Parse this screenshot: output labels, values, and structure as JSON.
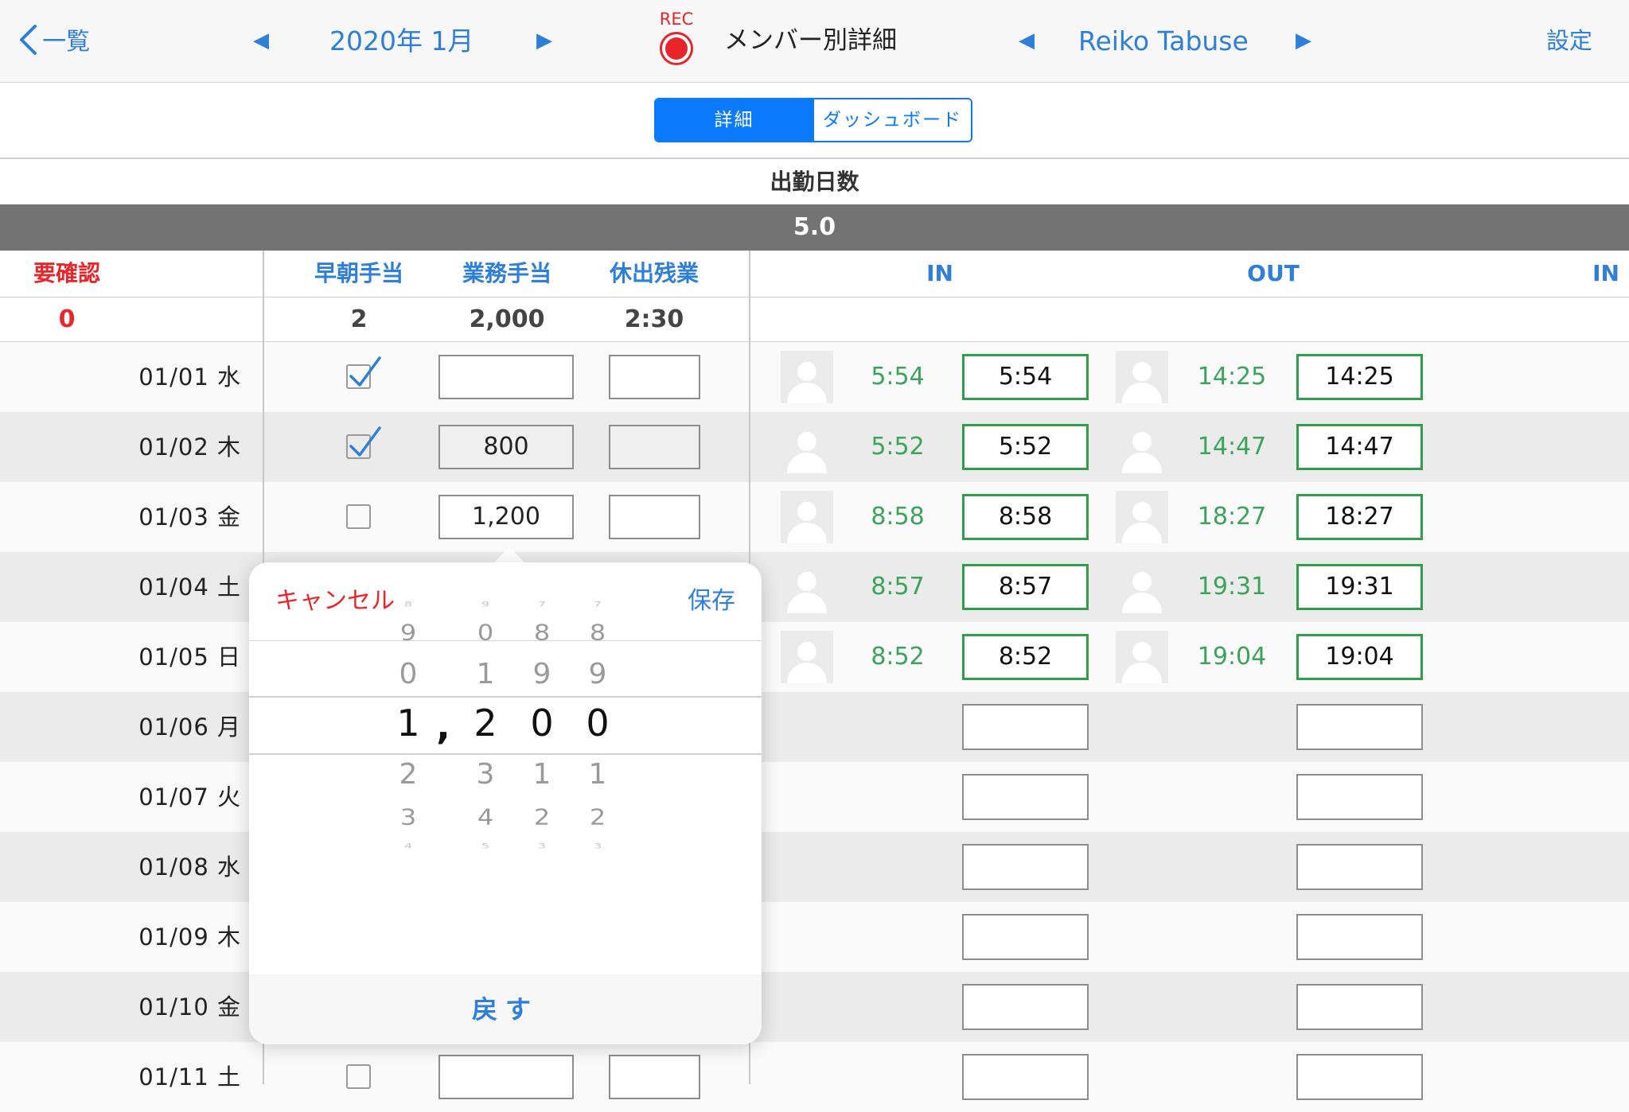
{
  "nav": {
    "back_label": "一覧",
    "month": "2020年 1月",
    "rec_label": "REC",
    "title": "メンバー別詳細",
    "member": "Reiko Tabuse",
    "settings": "設定"
  },
  "segment": {
    "detail": "詳細",
    "dashboard": "ダッシュボード"
  },
  "summary": {
    "label": "出勤日数",
    "value": "5.0"
  },
  "headers": {
    "confirm": "要確認",
    "early": "早朝手当",
    "work": "業務手当",
    "holiday": "休出残業",
    "in": "IN",
    "out": "OUT",
    "in2": "IN"
  },
  "totals": {
    "confirm": "0",
    "early": "2",
    "work": "2,000",
    "holiday": "2:30"
  },
  "rows": [
    {
      "date": "01/01 水",
      "checked": true,
      "work": "",
      "in_raw": "5:54",
      "in": "5:54",
      "out_raw": "14:25",
      "out": "14:25"
    },
    {
      "date": "01/02 木",
      "checked": true,
      "work": "800",
      "in_raw": "5:52",
      "in": "5:52",
      "out_raw": "14:47",
      "out": "14:47"
    },
    {
      "date": "01/03 金",
      "checked": false,
      "work": "1,200",
      "in_raw": "8:58",
      "in": "8:58",
      "out_raw": "18:27",
      "out": "18:27"
    },
    {
      "date": "01/04 土",
      "in_raw": "8:57",
      "in": "8:57",
      "out_raw": "19:31",
      "out": "19:31"
    },
    {
      "date": "01/05 日",
      "in_raw": "8:52",
      "in": "8:52",
      "out_raw": "19:04",
      "out": "19:04"
    },
    {
      "date": "01/06 月"
    },
    {
      "date": "01/07 火"
    },
    {
      "date": "01/08 水"
    },
    {
      "date": "01/09 木"
    },
    {
      "date": "01/10 金"
    },
    {
      "date": "01/11 土"
    }
  ],
  "popover": {
    "cancel": "キャンセル",
    "save": "保存",
    "back": "戻す",
    "selected": [
      "1",
      ",",
      "2",
      "0",
      "0"
    ],
    "picker": {
      "col1": [
        "8",
        "9",
        "0",
        "1",
        "2",
        "3",
        "4"
      ],
      "col2": [
        "9",
        "0",
        "1",
        "2",
        "3",
        "4",
        "5"
      ],
      "col3": [
        "7",
        "8",
        "9",
        "0",
        "1",
        "2",
        "3"
      ],
      "col4": [
        "7",
        "8",
        "9",
        "0",
        "1",
        "2",
        "3"
      ]
    }
  },
  "colors": {
    "accent": "#0a7afc",
    "red": "#e8262a",
    "green": "#2e9e4a",
    "summary_bar": "#737373"
  }
}
